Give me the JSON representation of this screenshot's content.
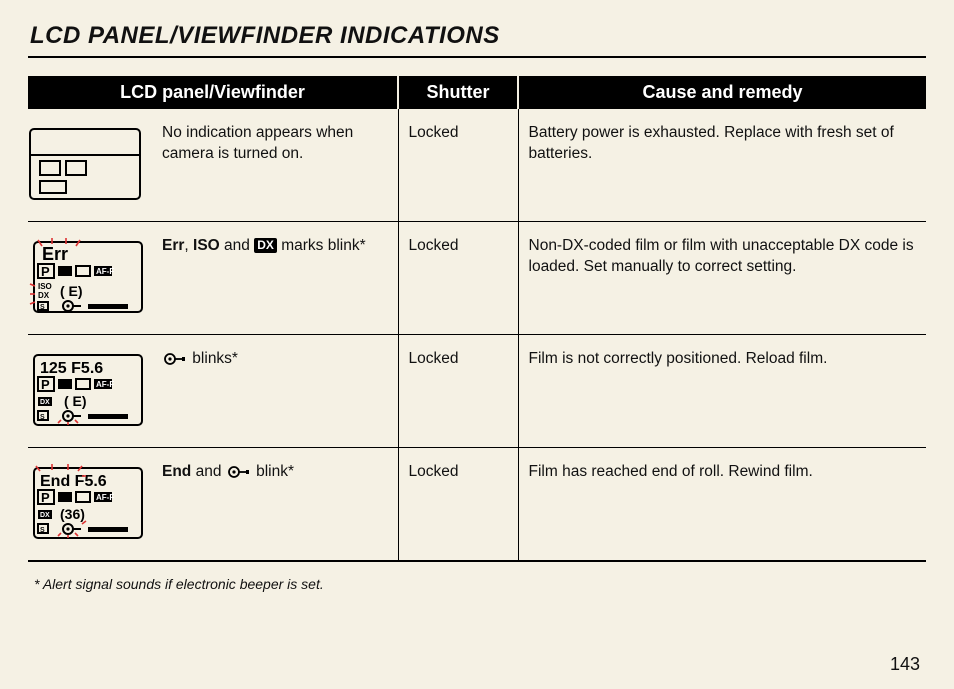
{
  "title": "LCD PANEL/VIEWFINDER INDICATIONS",
  "columns": {
    "panel": "LCD panel/Viewfinder",
    "shutter": "Shutter",
    "cause": "Cause and remedy"
  },
  "rows": [
    {
      "lcd_parts": [
        "No indication appears when camera is turned on."
      ],
      "shutter": "Locked",
      "cause": "Battery power is exhausted. Replace with fresh set of batteries."
    },
    {
      "lcd_parts": [
        "Err",
        ", ",
        "ISO",
        " and ",
        "DX",
        " marks blink*"
      ],
      "shutter": "Locked",
      "cause": "Non-DX-coded film or film with unacceptable DX code is loaded. Set manually to correct setting."
    },
    {
      "lcd_parts": [
        "",
        " blinks*"
      ],
      "shutter": "Locked",
      "cause": "Film is not correctly positioned. Reload film."
    },
    {
      "lcd_parts": [
        "End",
        " and ",
        "",
        " blink*"
      ],
      "shutter": "Locked",
      "cause": "Film has reached end of roll. Rewind film."
    }
  ],
  "footnote": "* Alert signal sounds if electronic beeper is set.",
  "page_number": "143",
  "lcd_glyphs": {
    "r1_top": "",
    "r2_top": "Err",
    "r2_frame": "( E)",
    "r3_top": "125  F5.6",
    "r3_frame": "(  E)",
    "r4_top": "End  F5.6",
    "r4_frame": "(36)"
  }
}
